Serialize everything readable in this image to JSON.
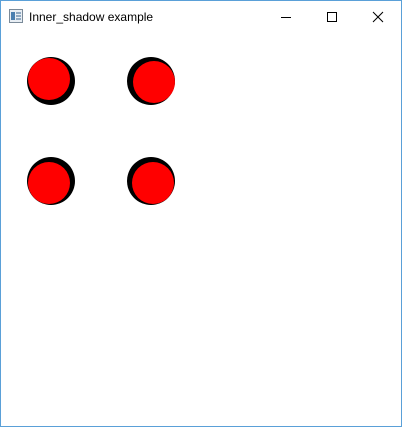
{
  "window": {
    "title": "Inner_shadow example",
    "controls": {
      "minimize_icon": "minimize-icon",
      "maximize_icon": "maximize-icon",
      "close_icon": "close-icon"
    }
  },
  "colors": {
    "circle_fill": "#ff0000",
    "shadow": "#000000",
    "window_border": "#5aa0d8",
    "background": "#ffffff"
  },
  "circles": [
    {
      "name": "shadow-circle-top-left",
      "shadow_direction": "bottom-right"
    },
    {
      "name": "shadow-circle-top-right",
      "shadow_direction": "bottom-left"
    },
    {
      "name": "shadow-circle-bottom-left",
      "shadow_direction": "top-right"
    },
    {
      "name": "shadow-circle-bottom-right",
      "shadow_direction": "top-left"
    }
  ]
}
